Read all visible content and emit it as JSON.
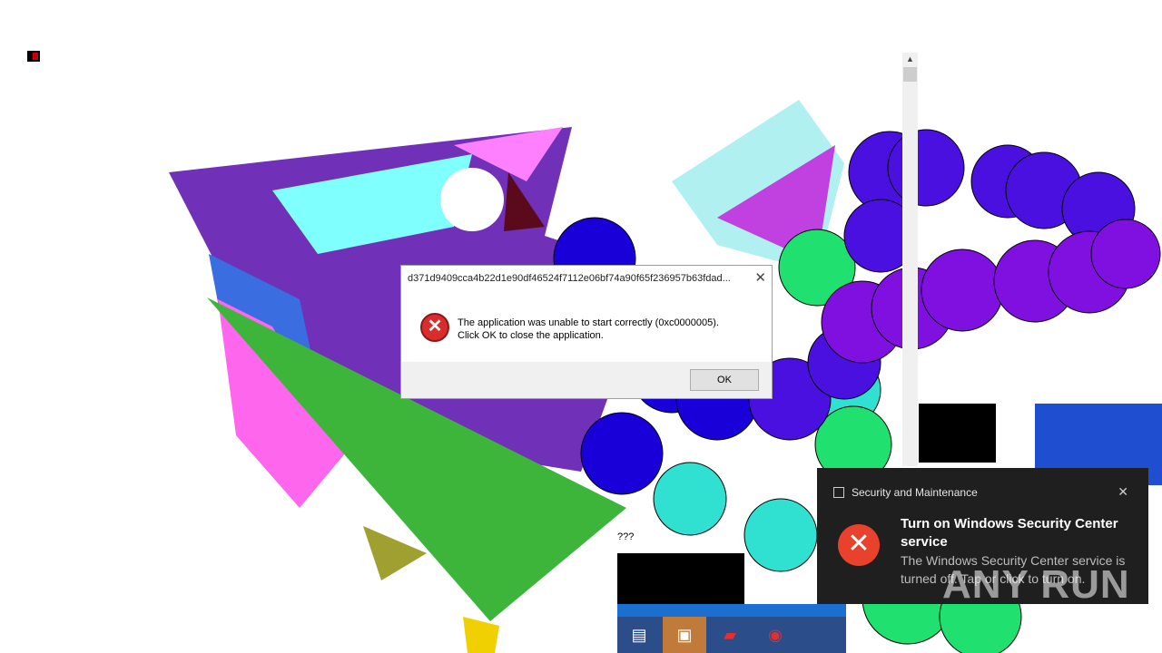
{
  "error_dialog": {
    "title": "d371d9409cca4b22d1e90df46524f7112e06bf74a90f65f236957b63fdad...",
    "close_glyph": "✕",
    "icon": "error-x-icon",
    "icon_glyph": "✕",
    "message_line1": "The application was unable to start correctly (0xc0000005).",
    "message_line2": "Click OK to close the application.",
    "ok_label": "OK"
  },
  "scrollbar": {
    "up_glyph": "▲"
  },
  "stray_text": "???",
  "toast": {
    "app_name": "Security and Maintenance",
    "close_glyph": "✕",
    "icon_glyph": "✕",
    "title": "Turn on Windows Security Center service",
    "body": "The Windows Security Center service is turned off. Tap or click to turn on."
  },
  "watermark": "ANY RUN",
  "taskbar": {
    "items": [
      {
        "name": "explorer-icon",
        "glyph": "▤"
      },
      {
        "name": "window-icon",
        "glyph": "▣"
      },
      {
        "name": "media-icon",
        "glyph": "▰"
      },
      {
        "name": "app-icon",
        "glyph": "◉"
      }
    ]
  },
  "colors": {
    "toast_bg": "#1f1f1f",
    "error_red": "#d92d2d",
    "toast_icon_red": "#e8412c",
    "taskbar_bg": "#2b4d8a"
  }
}
